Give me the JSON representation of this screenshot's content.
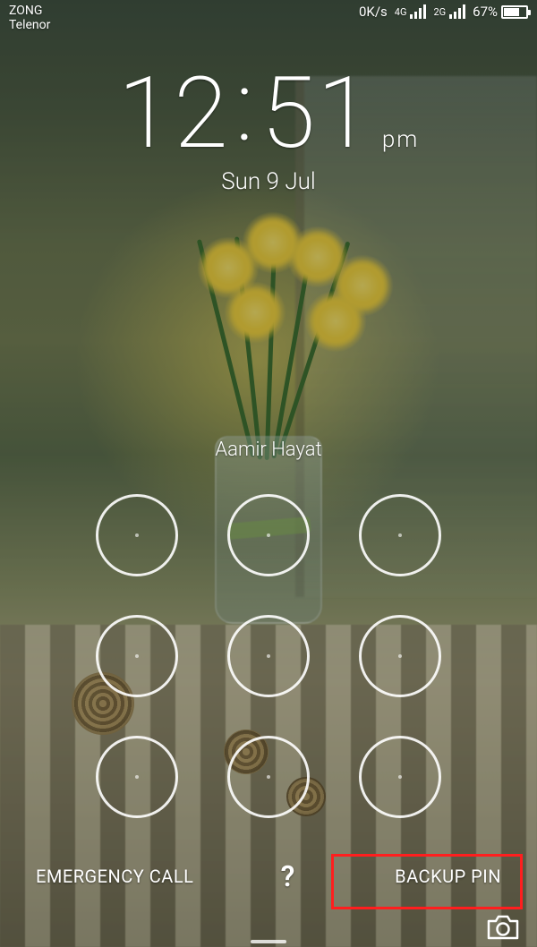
{
  "statusbar": {
    "carrier1": "ZONG",
    "carrier2": "Telenor",
    "data_speed": "0K/s",
    "net1_label": "4G",
    "net2_label": "2G",
    "battery_percent": "67%"
  },
  "clock": {
    "hours": "12",
    "minutes": "51",
    "ampm": "pm",
    "date": "Sun 9 Jul"
  },
  "owner_name": "Aamir Hayat",
  "buttons": {
    "emergency": "EMERGENCY CALL",
    "help": "?",
    "backup_pin": "BACKUP PIN"
  }
}
